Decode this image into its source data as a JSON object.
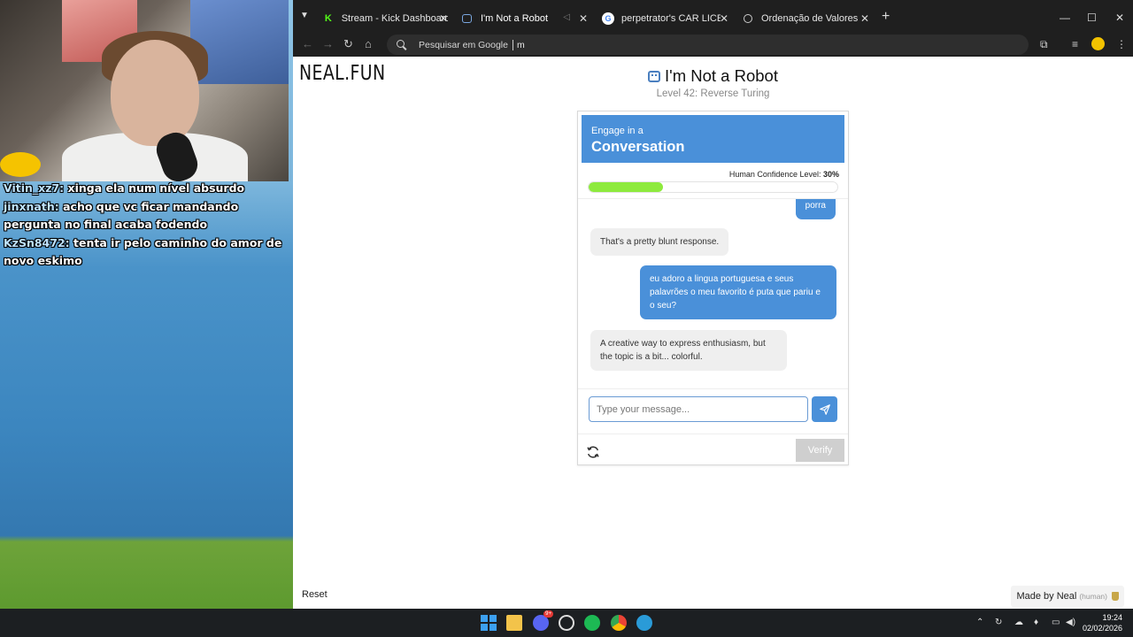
{
  "stream_chat": [
    {
      "user": "Vitin_xz7:",
      "message": "xinga ela num nível absurdo"
    },
    {
      "user": "jinxnath:",
      "message": "acho que vc ficar mandando pergunta no final acaba fodendo"
    },
    {
      "user": "KzSn8472:",
      "message": "tenta ir pelo caminho do amor de novo eskimo"
    }
  ],
  "browser": {
    "tabs": [
      {
        "title": "Stream - Kick Dashboard",
        "favicon": "kick-icon",
        "active": false
      },
      {
        "title": "I'm Not a Robot",
        "favicon": "robot-icon",
        "active": true
      },
      {
        "title": "perpetrator's CAR LICENSE - Pe",
        "favicon": "google-icon",
        "active": false
      },
      {
        "title": "Ordenação de Valores Matemát",
        "favicon": "globe-icon",
        "active": false
      }
    ],
    "omnibox_placeholder": "Pesquisar em Google",
    "omnibox_value": "m"
  },
  "page": {
    "logo": "NEAL.FUN",
    "title": "I'm Not a Robot",
    "subtitle": "Level 42: Reverse Turing",
    "challenge": {
      "header_pre": "Engage in a",
      "header_main": "Conversation",
      "confidence_label": "Human Confidence Level:",
      "confidence_value": "30%",
      "confidence_fraction": 0.3,
      "messages": [
        {
          "from": "user",
          "text": "porra"
        },
        {
          "from": "bot",
          "text": "That's a pretty blunt response."
        },
        {
          "from": "user",
          "text": "eu adoro a lingua portuguesa e seus palavrões o meu favorito é puta que pariu e o seu?"
        },
        {
          "from": "bot",
          "text": "A creative way to express enthusiasm, but the topic is a bit... colorful."
        }
      ],
      "input_placeholder": "Type your message...",
      "verify_label": "Verify"
    },
    "reset_label": "Reset",
    "made_by_label": "Made by Neal",
    "made_by_badge": "(human)"
  },
  "taskbar": {
    "time": "19:24",
    "date": "02/02/2026",
    "discord_badge": "9+"
  },
  "colors": {
    "accent_blue": "#4a90d9",
    "confidence_green": "#8eea3e",
    "browser_chrome": "#1f1f1f"
  }
}
